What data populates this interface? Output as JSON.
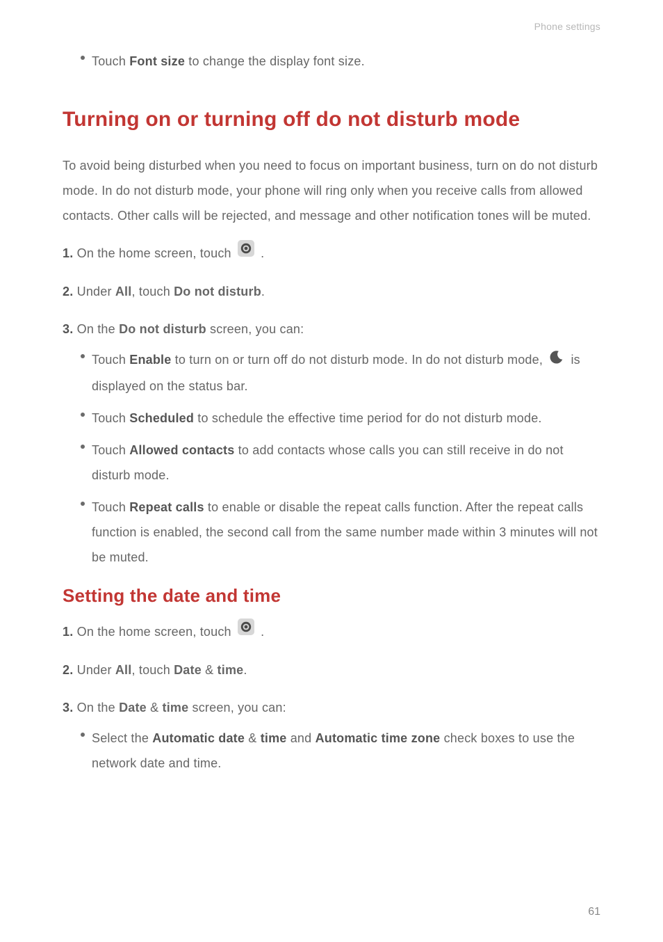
{
  "header": {
    "section_label": "Phone settings"
  },
  "intro_bullet": {
    "prefix": "Touch ",
    "bold": "Font size",
    "suffix": " to change the display font size."
  },
  "section1": {
    "heading": "Turning on or turning off do not disturb mode",
    "paragraph": "To avoid being disturbed when you need to focus on important business, turn on do not disturb mode. In do not disturb mode, your phone will ring only when you receive calls from allowed contacts. Other calls will be rejected, and message and other notification tones will be muted.",
    "step1": {
      "num": "1.",
      "prefix": " On the home screen, touch ",
      "suffix": " ."
    },
    "step2": {
      "num": "2.",
      "prefix": " Under ",
      "bold1": "All",
      "mid": ", touch ",
      "bold2": "Do not disturb",
      "suffix": "."
    },
    "step3": {
      "num": "3.",
      "prefix": " On the ",
      "bold": "Do not disturb",
      "suffix": " screen, you can:"
    },
    "bullets": {
      "b1": {
        "prefix": "Touch ",
        "bold": "Enable",
        "mid": " to turn on or turn off do not disturb mode. In do not disturb mode, ",
        "suffix": " is displayed on the status bar."
      },
      "b2": {
        "prefix": "Touch ",
        "bold": "Scheduled",
        "suffix": " to schedule the effective time period for do not disturb mode."
      },
      "b3": {
        "prefix": "Touch ",
        "bold": "Allowed contacts",
        "suffix": " to add contacts whose calls you can still receive in do not disturb mode."
      },
      "b4": {
        "prefix": "Touch ",
        "bold": "Repeat calls",
        "suffix": " to enable or disable the repeat calls function. After the repeat calls function is enabled, the second call from the same number made within 3 minutes will not be muted."
      }
    }
  },
  "section2": {
    "heading": "Setting the date and time",
    "step1": {
      "num": "1.",
      "prefix": " On the home screen, touch ",
      "suffix": " ."
    },
    "step2": {
      "num": "2.",
      "prefix": " Under ",
      "bold1": "All",
      "mid": ", touch ",
      "bold2": "Date",
      "amp": " & ",
      "bold3": "time",
      "suffix": "."
    },
    "step3": {
      "num": "3.",
      "prefix": " On the ",
      "bold1": "Date",
      "amp": " & ",
      "bold2": "time",
      "suffix": " screen, you can:"
    },
    "bullets": {
      "b1": {
        "prefix": "Select the ",
        "bold1": "Automatic date",
        "amp1": " & ",
        "bold2": "time",
        "mid": " and ",
        "bold3": "Automatic time zone",
        "suffix": " check boxes to use the network date and time."
      }
    }
  },
  "page_number": "61"
}
